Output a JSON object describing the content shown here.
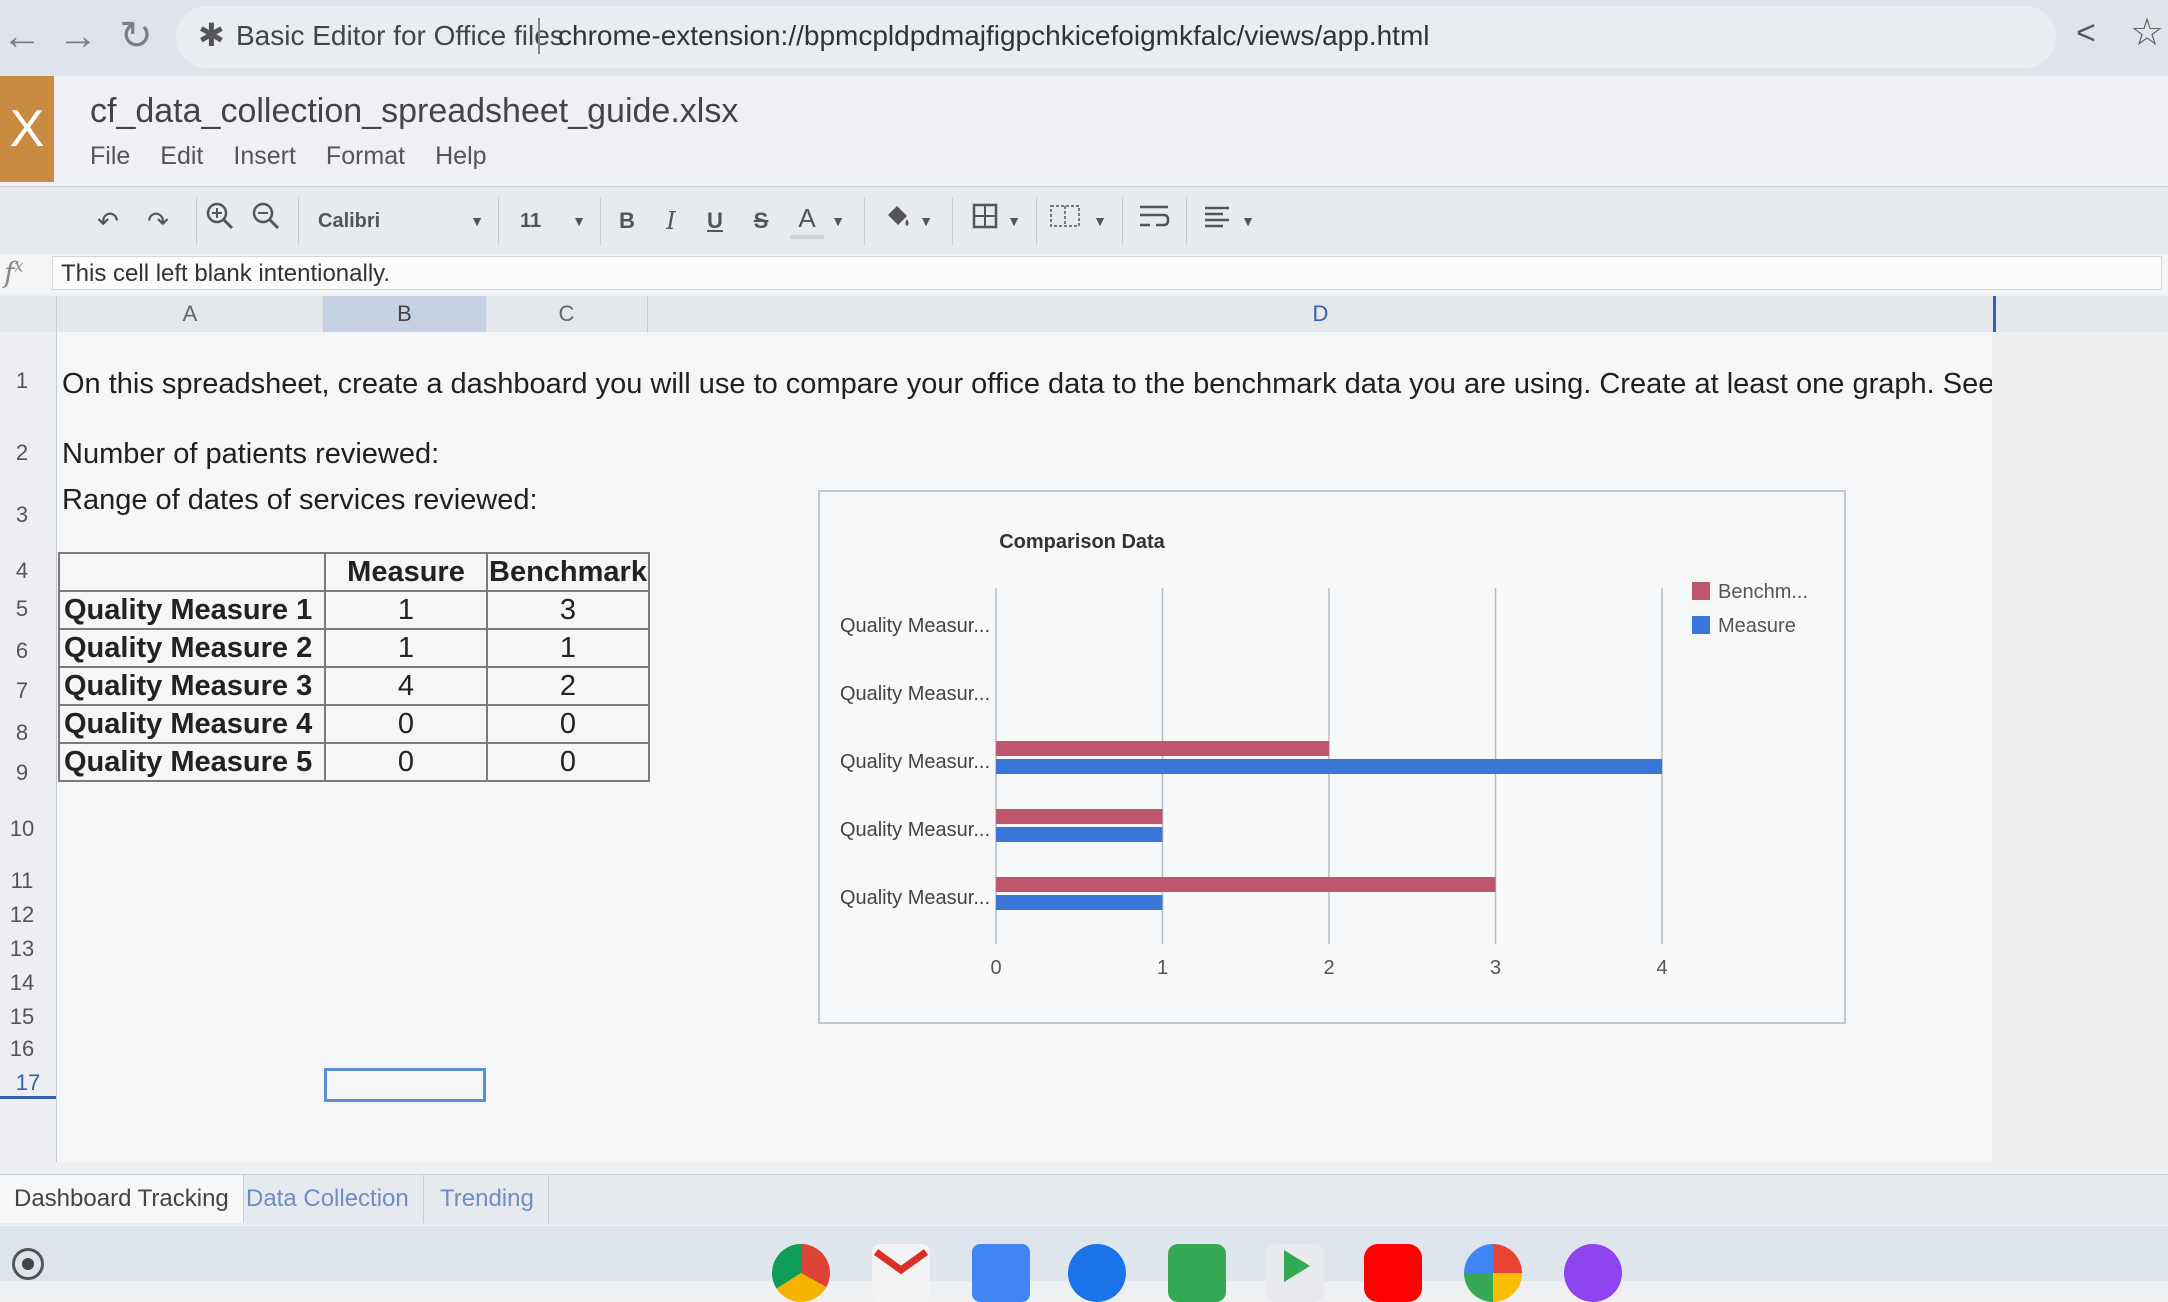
{
  "browser": {
    "tab_title": "Basic Editor for Office files",
    "url": "chrome-extension://bpmcpldpdmajfigpchkicefoigmkfalc/views/app.html"
  },
  "app": {
    "logo": "X",
    "file_name": "cf_data_collection_spreadsheet_guide.xlsx",
    "menu": [
      "File",
      "Edit",
      "Insert",
      "Format",
      "Help"
    ]
  },
  "toolbar": {
    "font_family": "Calibri",
    "font_size": "11",
    "bold": "B",
    "italic": "I",
    "underline": "U",
    "strike": "S",
    "font_color": "A"
  },
  "formula_bar": {
    "fx": "f",
    "value": "This cell left blank intentionally."
  },
  "columns": [
    "A",
    "B",
    "C",
    "D"
  ],
  "rows": [
    "1",
    "2",
    "3",
    "4",
    "5",
    "6",
    "7",
    "8",
    "9",
    "10",
    "11",
    "12",
    "13",
    "14",
    "15",
    "16",
    "17"
  ],
  "cells": {
    "row1": "On this spreadsheet, create a dashboard you will use to compare your office data to the benchmark data you are using. Create at least one graph. See ex",
    "row2": "Number of patients reviewed:",
    "row3": "Range of dates of services reviewed:"
  },
  "table": {
    "headers": [
      "",
      "Measure",
      "Benchmark"
    ],
    "rows": [
      {
        "label": "Quality Measure 1",
        "measure": "1",
        "benchmark": "3"
      },
      {
        "label": "Quality Measure 2",
        "measure": "1",
        "benchmark": "1"
      },
      {
        "label": "Quality Measure 3",
        "measure": "4",
        "benchmark": "2"
      },
      {
        "label": "Quality Measure 4",
        "measure": "0",
        "benchmark": "0"
      },
      {
        "label": "Quality Measure 5",
        "measure": "0",
        "benchmark": "0"
      }
    ]
  },
  "chart_data": {
    "type": "bar",
    "orientation": "horizontal",
    "title": "Comparison Data",
    "categories": [
      "Quality Measur...",
      "Quality Measur...",
      "Quality Measur...",
      "Quality Measur...",
      "Quality Measur..."
    ],
    "series": [
      {
        "name": "Benchm...",
        "values": [
          0,
          0,
          2,
          1,
          3
        ],
        "color": "#c0566b"
      },
      {
        "name": "Measure",
        "values": [
          0,
          0,
          4,
          1,
          1
        ],
        "color": "#3a75d8"
      }
    ],
    "xlim": [
      0,
      4
    ],
    "xticks": [
      "0",
      "1",
      "2",
      "3",
      "4"
    ],
    "grid": true,
    "legend": "right"
  },
  "sheet_tabs": [
    "Dashboard Tracking",
    "Data Collection",
    "Trending"
  ],
  "active_tab": "Dashboard Tracking"
}
